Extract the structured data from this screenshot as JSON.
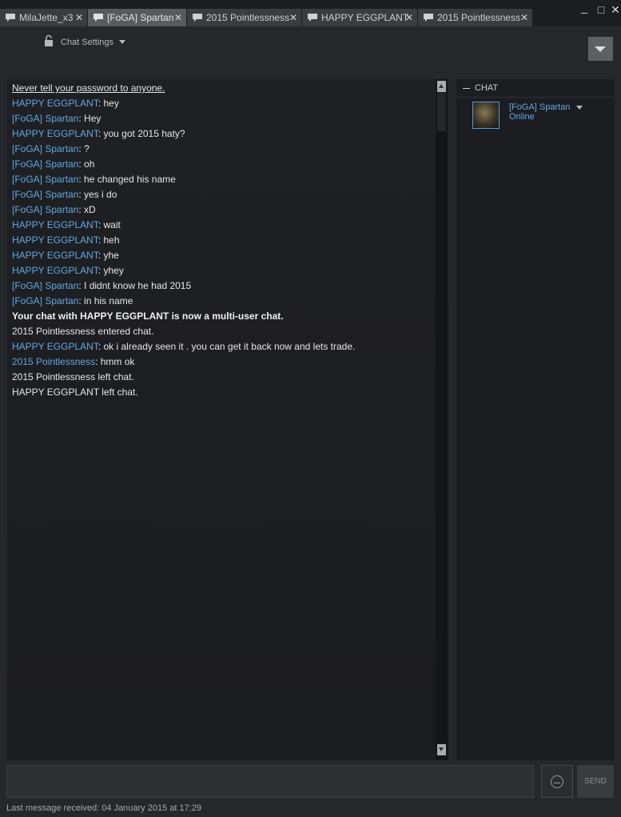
{
  "tabs": [
    {
      "label": "MilaJette_x3",
      "active": false
    },
    {
      "label": "[FoGA] Spartan",
      "active": true
    },
    {
      "label": "2015 Pointlessness",
      "active": false
    },
    {
      "label": "HAPPY EGGPLANT",
      "active": false
    },
    {
      "label": "2015 Pointlessness",
      "active": false
    }
  ],
  "tab_close_glyph": "✕",
  "window": {
    "minimize": "_",
    "maximize": "□",
    "close": "✕"
  },
  "settings": {
    "label": "Chat Settings"
  },
  "notice": "Never tell your password to anyone.",
  "messages": [
    {
      "sender": "HAPPY EGGPLANT",
      "text": ": hey"
    },
    {
      "sender": "[FoGA] Spartan",
      "text": ": Hey"
    },
    {
      "sender": "HAPPY EGGPLANT",
      "text": ": you got 2015 haty?"
    },
    {
      "sender": "[FoGA] Spartan",
      "text": ": ?"
    },
    {
      "sender": "[FoGA] Spartan",
      "text": ": oh"
    },
    {
      "sender": "[FoGA] Spartan",
      "text": ": he changed his name"
    },
    {
      "sender": "[FoGA] Spartan",
      "text": ": yes i do"
    },
    {
      "sender": "[FoGA] Spartan",
      "text": ": xD"
    },
    {
      "sender": "HAPPY EGGPLANT",
      "text": ": wait"
    },
    {
      "sender": "HAPPY EGGPLANT",
      "text": ": heh"
    },
    {
      "sender": "HAPPY EGGPLANT",
      "text": ": yhe"
    },
    {
      "sender": "HAPPY EGGPLANT",
      "text": ": yhey"
    },
    {
      "sender": "[FoGA] Spartan",
      "text": ": I didnt know he had 2015"
    },
    {
      "sender": "[FoGA] Spartan",
      "text": ": in his name"
    },
    {
      "system": "Your chat with HAPPY EGGPLANT is now a multi-user chat.",
      "bold": true
    },
    {
      "system": "2015 Pointlessness entered chat."
    },
    {
      "sender": "HAPPY EGGPLANT",
      "text": ": ok i already seen it . you can get it back now and lets trade."
    },
    {
      "sender": "2015 Pointlessness",
      "text": ": hmm ok"
    },
    {
      "system": "2015 Pointlessness left chat."
    },
    {
      "system": "HAPPY EGGPLANT left chat."
    }
  ],
  "members": {
    "header": "CHAT",
    "list": [
      {
        "name": "[FoGA] Spartan",
        "status": "Online"
      }
    ]
  },
  "input": {
    "value": "",
    "placeholder": ""
  },
  "send_label": "SEND",
  "status_bar": "Last message received: 04 January 2015 at 17:29",
  "icons": {
    "tab": "chat-bubble-icon",
    "settings": "lock-icon",
    "emoticon": "emoticon-icon",
    "menu": "dropdown-menu-icon"
  },
  "colors": {
    "sender": "#62a7e3",
    "background": "#25272b",
    "active_tab": "#585a5e"
  }
}
